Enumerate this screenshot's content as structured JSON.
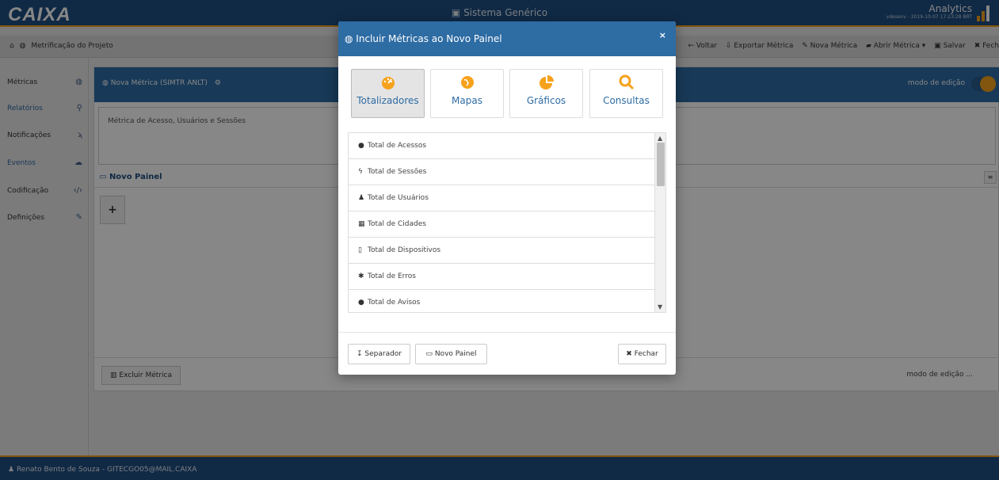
{
  "app": {
    "logo": "CAIXA",
    "system_title": "Sistema Genérico",
    "analytics_title": "Analytics",
    "analytics_meta": "vdesenv - 2019-10-07 17:23:28 BRT"
  },
  "breadcrumb": {
    "label": "Metrificação do Projeto"
  },
  "toolbar": {
    "voltar": "Voltar",
    "exportar": "Exportar Métrica",
    "nova": "Nova Métrica",
    "abrir": "Abrir Métrica",
    "salvar": "Salvar",
    "fechar": "Fech"
  },
  "sidebar": {
    "items": [
      {
        "label": "Métricas",
        "icon": "dashboard-icon"
      },
      {
        "label": "Relatórios",
        "icon": "search-icon"
      },
      {
        "label": "Notificações",
        "icon": "rss-icon"
      },
      {
        "label": "Eventos",
        "icon": "cloud-icon"
      },
      {
        "label": "Codificação",
        "icon": "code-icon"
      },
      {
        "label": "Definições",
        "icon": "edit-icon"
      }
    ]
  },
  "main": {
    "title": "Nova Métrica (SIMTR ANLT)",
    "mode_label": "modo de edição",
    "description": "Métrica de Acesso, Usuários e Sessões",
    "painel_title": "Novo Painel",
    "plus": "+",
    "excluir_label": "Excluir Métrica",
    "mode_label_footer": "modo de edição ..."
  },
  "footer": {
    "user": "Renato Bento de Souza - GITECGO05@MAIL.CAIXA"
  },
  "modal": {
    "title": "Incluir Métricas ao Novo Painel",
    "close": "×",
    "categories": [
      {
        "label": "Totalizadores",
        "icon": "dashboard-gauge-icon",
        "active": true
      },
      {
        "label": "Mapas",
        "icon": "globe-icon",
        "active": false
      },
      {
        "label": "Gráficos",
        "icon": "pie-chart-icon",
        "active": false
      },
      {
        "label": "Consultas",
        "icon": "search-icon",
        "active": false
      }
    ],
    "items": [
      {
        "label": "Total de Acessos",
        "icon": "globe-icon",
        "glyph": "●"
      },
      {
        "label": "Total de Sessões",
        "icon": "bolt-icon",
        "glyph": "ϟ"
      },
      {
        "label": "Total de Usuários",
        "icon": "user-icon",
        "glyph": "♟"
      },
      {
        "label": "Total de Cidades",
        "icon": "building-icon",
        "glyph": "▦"
      },
      {
        "label": "Total de Dispositivos",
        "icon": "mobile-icon",
        "glyph": "▯"
      },
      {
        "label": "Total de Erros",
        "icon": "bug-icon",
        "glyph": "✱"
      },
      {
        "label": "Total de Avisos",
        "icon": "exclamation-circle-icon",
        "glyph": "●"
      }
    ],
    "btn_separador": "Separador",
    "btn_novo_painel": "Novo Painel",
    "btn_fechar": "Fechar"
  },
  "colors": {
    "primary": "#1f4f83",
    "header_blue": "#2e6ca4",
    "accent": "#f6a21c"
  }
}
